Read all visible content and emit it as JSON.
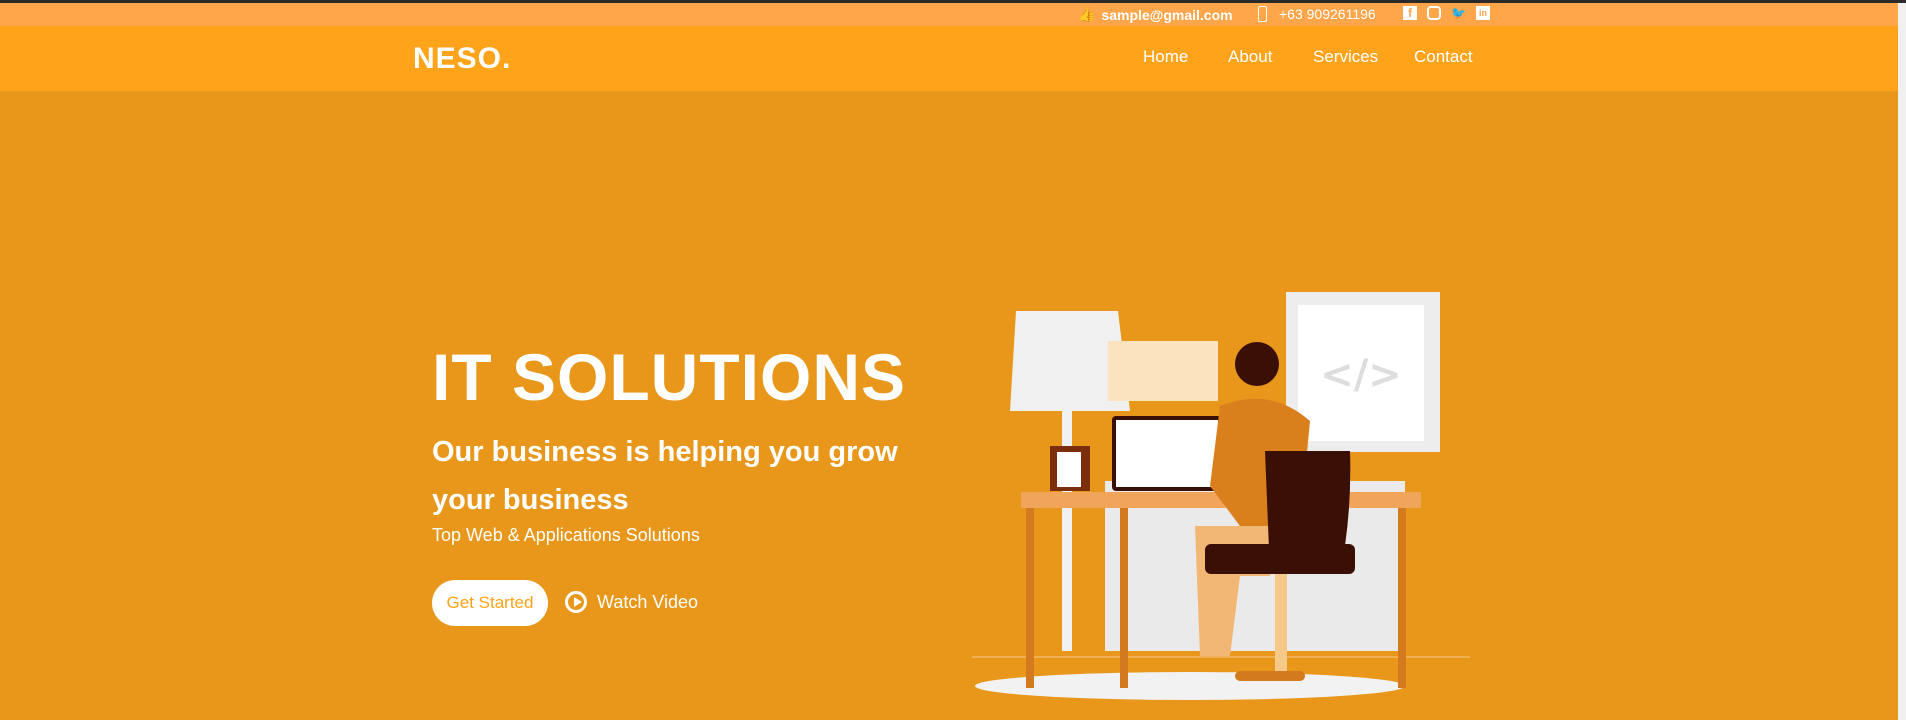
{
  "topbar": {
    "email": "sample@gmail.com",
    "phone": "+63 909261196",
    "social": [
      "facebook-icon",
      "instagram-icon",
      "twitter-icon",
      "linkedin-icon"
    ]
  },
  "nav": {
    "logo": "NESO.",
    "items": [
      "Home",
      "About",
      "Services",
      "Contact"
    ]
  },
  "hero": {
    "title": "IT SOLUTIONS",
    "subtitle": "Our business is helping you grow your business",
    "tagline": "Top Web & Applications Solutions",
    "cta": "Get Started",
    "watch": "Watch Video",
    "code_symbol": "</>"
  },
  "colors": {
    "topbar": "#ffa54a",
    "nav": "#ffa31a",
    "hero": "#e8971a"
  }
}
